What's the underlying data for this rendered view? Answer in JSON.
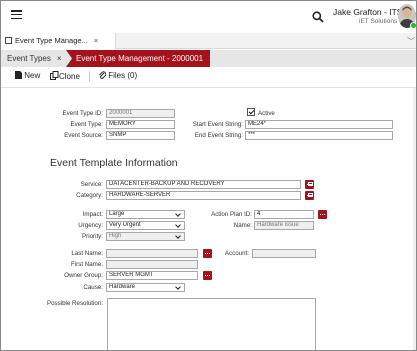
{
  "header": {
    "user_name": "Jake Grafton - ITSM MGMT",
    "user_org": "iET Solutions"
  },
  "doc_tab": {
    "label": "Event Type Manage...",
    "close": "×"
  },
  "breadcrumb": [
    {
      "label": "Event Types",
      "close": "×"
    },
    {
      "label": "Event Type Management - 2000001",
      "close": "×"
    }
  ],
  "toolbar": {
    "new_label": "New",
    "clone_label": "Clone",
    "files_label": "Files (0)"
  },
  "form": {
    "event_type_id": {
      "label": "Event Type ID:",
      "value": "2000001"
    },
    "event_type": {
      "label": "Event Type:",
      "value": "MEMORY"
    },
    "event_source": {
      "label": "Event Source:",
      "value": "SNMP"
    },
    "active": {
      "label": "Active",
      "checked": true
    },
    "start_event_string": {
      "label": "Start Event String:",
      "value": "ME24*"
    },
    "end_event_string": {
      "label": "End Event String:",
      "value": "***"
    }
  },
  "template": {
    "title": "Event Template Information",
    "service": {
      "label": "Service:",
      "value": "DATACENTER-BACKUP AND RECOVERY"
    },
    "category": {
      "label": "Category:",
      "value": "HARDWARE-SERVER"
    },
    "impact": {
      "label": "Impact:",
      "value": "Large"
    },
    "urgency": {
      "label": "Urgency:",
      "value": "Very Urgent"
    },
    "priority": {
      "label": "Priority:",
      "value": "High"
    },
    "action_plan_id": {
      "label": "Action Plan ID:",
      "value": "4"
    },
    "name": {
      "label": "Name:",
      "value": "Hardware issue"
    },
    "last_name": {
      "label": "Last Name:",
      "value": ""
    },
    "first_name": {
      "label": "First Name:",
      "value": ""
    },
    "account": {
      "label": "Account:",
      "value": ""
    },
    "owner_group": {
      "label": "Owner Group:",
      "value": "SERVER MGMT"
    },
    "cause": {
      "label": "Cause:",
      "value": "Hardware"
    },
    "possible_resolution": {
      "label": "Possible Resolution:",
      "value": ""
    }
  },
  "colors": {
    "accent": "#a4121c",
    "status_online": "#2db52d"
  }
}
